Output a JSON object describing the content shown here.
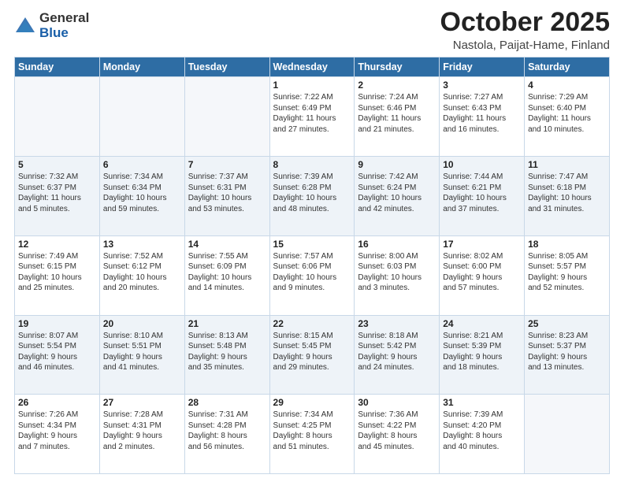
{
  "header": {
    "logo_general": "General",
    "logo_blue": "Blue",
    "month": "October 2025",
    "location": "Nastola, Paijat-Hame, Finland"
  },
  "days_of_week": [
    "Sunday",
    "Monday",
    "Tuesday",
    "Wednesday",
    "Thursday",
    "Friday",
    "Saturday"
  ],
  "weeks": [
    [
      {
        "day": "",
        "info": ""
      },
      {
        "day": "",
        "info": ""
      },
      {
        "day": "",
        "info": ""
      },
      {
        "day": "1",
        "info": "Sunrise: 7:22 AM\nSunset: 6:49 PM\nDaylight: 11 hours\nand 27 minutes."
      },
      {
        "day": "2",
        "info": "Sunrise: 7:24 AM\nSunset: 6:46 PM\nDaylight: 11 hours\nand 21 minutes."
      },
      {
        "day": "3",
        "info": "Sunrise: 7:27 AM\nSunset: 6:43 PM\nDaylight: 11 hours\nand 16 minutes."
      },
      {
        "day": "4",
        "info": "Sunrise: 7:29 AM\nSunset: 6:40 PM\nDaylight: 11 hours\nand 10 minutes."
      }
    ],
    [
      {
        "day": "5",
        "info": "Sunrise: 7:32 AM\nSunset: 6:37 PM\nDaylight: 11 hours\nand 5 minutes."
      },
      {
        "day": "6",
        "info": "Sunrise: 7:34 AM\nSunset: 6:34 PM\nDaylight: 10 hours\nand 59 minutes."
      },
      {
        "day": "7",
        "info": "Sunrise: 7:37 AM\nSunset: 6:31 PM\nDaylight: 10 hours\nand 53 minutes."
      },
      {
        "day": "8",
        "info": "Sunrise: 7:39 AM\nSunset: 6:28 PM\nDaylight: 10 hours\nand 48 minutes."
      },
      {
        "day": "9",
        "info": "Sunrise: 7:42 AM\nSunset: 6:24 PM\nDaylight: 10 hours\nand 42 minutes."
      },
      {
        "day": "10",
        "info": "Sunrise: 7:44 AM\nSunset: 6:21 PM\nDaylight: 10 hours\nand 37 minutes."
      },
      {
        "day": "11",
        "info": "Sunrise: 7:47 AM\nSunset: 6:18 PM\nDaylight: 10 hours\nand 31 minutes."
      }
    ],
    [
      {
        "day": "12",
        "info": "Sunrise: 7:49 AM\nSunset: 6:15 PM\nDaylight: 10 hours\nand 25 minutes."
      },
      {
        "day": "13",
        "info": "Sunrise: 7:52 AM\nSunset: 6:12 PM\nDaylight: 10 hours\nand 20 minutes."
      },
      {
        "day": "14",
        "info": "Sunrise: 7:55 AM\nSunset: 6:09 PM\nDaylight: 10 hours\nand 14 minutes."
      },
      {
        "day": "15",
        "info": "Sunrise: 7:57 AM\nSunset: 6:06 PM\nDaylight: 10 hours\nand 9 minutes."
      },
      {
        "day": "16",
        "info": "Sunrise: 8:00 AM\nSunset: 6:03 PM\nDaylight: 10 hours\nand 3 minutes."
      },
      {
        "day": "17",
        "info": "Sunrise: 8:02 AM\nSunset: 6:00 PM\nDaylight: 9 hours\nand 57 minutes."
      },
      {
        "day": "18",
        "info": "Sunrise: 8:05 AM\nSunset: 5:57 PM\nDaylight: 9 hours\nand 52 minutes."
      }
    ],
    [
      {
        "day": "19",
        "info": "Sunrise: 8:07 AM\nSunset: 5:54 PM\nDaylight: 9 hours\nand 46 minutes."
      },
      {
        "day": "20",
        "info": "Sunrise: 8:10 AM\nSunset: 5:51 PM\nDaylight: 9 hours\nand 41 minutes."
      },
      {
        "day": "21",
        "info": "Sunrise: 8:13 AM\nSunset: 5:48 PM\nDaylight: 9 hours\nand 35 minutes."
      },
      {
        "day": "22",
        "info": "Sunrise: 8:15 AM\nSunset: 5:45 PM\nDaylight: 9 hours\nand 29 minutes."
      },
      {
        "day": "23",
        "info": "Sunrise: 8:18 AM\nSunset: 5:42 PM\nDaylight: 9 hours\nand 24 minutes."
      },
      {
        "day": "24",
        "info": "Sunrise: 8:21 AM\nSunset: 5:39 PM\nDaylight: 9 hours\nand 18 minutes."
      },
      {
        "day": "25",
        "info": "Sunrise: 8:23 AM\nSunset: 5:37 PM\nDaylight: 9 hours\nand 13 minutes."
      }
    ],
    [
      {
        "day": "26",
        "info": "Sunrise: 7:26 AM\nSunset: 4:34 PM\nDaylight: 9 hours\nand 7 minutes."
      },
      {
        "day": "27",
        "info": "Sunrise: 7:28 AM\nSunset: 4:31 PM\nDaylight: 9 hours\nand 2 minutes."
      },
      {
        "day": "28",
        "info": "Sunrise: 7:31 AM\nSunset: 4:28 PM\nDaylight: 8 hours\nand 56 minutes."
      },
      {
        "day": "29",
        "info": "Sunrise: 7:34 AM\nSunset: 4:25 PM\nDaylight: 8 hours\nand 51 minutes."
      },
      {
        "day": "30",
        "info": "Sunrise: 7:36 AM\nSunset: 4:22 PM\nDaylight: 8 hours\nand 45 minutes."
      },
      {
        "day": "31",
        "info": "Sunrise: 7:39 AM\nSunset: 4:20 PM\nDaylight: 8 hours\nand 40 minutes."
      },
      {
        "day": "",
        "info": ""
      }
    ]
  ]
}
